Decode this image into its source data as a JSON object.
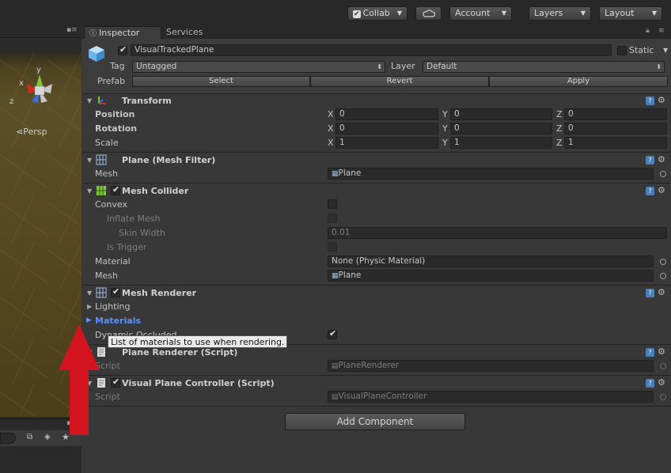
{
  "toolbar": {
    "collab": "Collab",
    "account": "Account",
    "layers": "Layers",
    "layout": "Layout"
  },
  "scene": {
    "persp_label": "Persp",
    "gizmo_y": "y",
    "gizmo_x": "x",
    "gizmo_z": "z"
  },
  "tabs": {
    "inspector": "Inspector",
    "services": "Services"
  },
  "object": {
    "active": true,
    "name": "VisualTrackedPlane",
    "static_label": "Static",
    "tag_label": "Tag",
    "tag_value": "Untagged",
    "layer_label": "Layer",
    "layer_value": "Default",
    "prefab_label": "Prefab",
    "prefab_select": "Select",
    "prefab_revert": "Revert",
    "prefab_apply": "Apply"
  },
  "transform": {
    "title": "Transform",
    "position_label": "Position",
    "rotation_label": "Rotation",
    "scale_label": "Scale",
    "axis_x": "X",
    "axis_y": "Y",
    "axis_z": "Z",
    "position": {
      "x": "0",
      "y": "0",
      "z": "0"
    },
    "rotation": {
      "x": "0",
      "y": "0",
      "z": "0"
    },
    "scale": {
      "x": "1",
      "y": "1",
      "z": "1"
    }
  },
  "mesh_filter": {
    "title": "Plane (Mesh Filter)",
    "mesh_label": "Mesh",
    "mesh_value": "Plane"
  },
  "mesh_collider": {
    "title": "Mesh Collider",
    "enabled": true,
    "convex_label": "Convex",
    "inflate_label": "Inflate Mesh",
    "skin_label": "Skin Width",
    "skin_value": "0.01",
    "trigger_label": "Is Trigger",
    "material_label": "Material",
    "material_value": "None (Physic Material)",
    "mesh_label": "Mesh",
    "mesh_value": "Plane"
  },
  "mesh_renderer": {
    "title": "Mesh Renderer",
    "enabled": true,
    "lighting_label": "Lighting",
    "materials_label": "Materials",
    "dynamic_label": "Dynamic Occluded",
    "dynamic_checked": true
  },
  "tooltip": "List of materials to use when rendering.",
  "plane_renderer": {
    "title": "Plane Renderer (Script)",
    "script_label": "Script",
    "script_value": "PlaneRenderer"
  },
  "visual_controller": {
    "title": "Visual Plane Controller (Script)",
    "enabled": true,
    "script_label": "Script",
    "script_value": "VisualPlaneController"
  },
  "add_component": "Add Component",
  "colors": {
    "accent_materials": "#5a8fff",
    "annotation_arrow": "#d3141f"
  }
}
